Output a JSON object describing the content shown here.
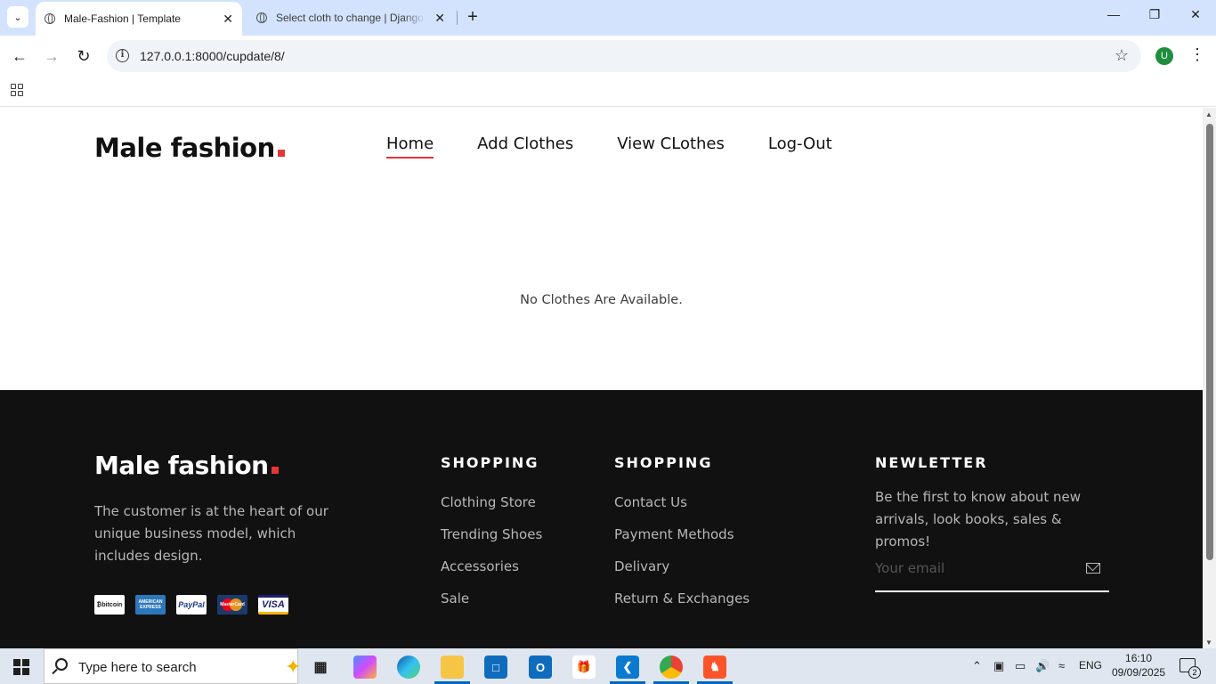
{
  "browser": {
    "tabs": [
      {
        "title": "Male-Fashion | Template",
        "active": true
      },
      {
        "title": "Select cloth to change | Django",
        "active": false
      }
    ],
    "url": "127.0.0.1:8000/cupdate/8/",
    "profile_initial": "U"
  },
  "site": {
    "logo_text": "Male fashion",
    "nav": [
      {
        "label": "Home",
        "active": true
      },
      {
        "label": "Add Clothes",
        "active": false
      },
      {
        "label": "View CLothes",
        "active": false
      },
      {
        "label": "Log-Out",
        "active": false
      }
    ],
    "empty_message": "No Clothes Are Available."
  },
  "footer": {
    "logo_text": "Male fashion",
    "about": "The customer is at the heart of our unique business model, which includes design.",
    "payments": [
      "bitcoin",
      "American Express",
      "PayPal",
      "MasterCard",
      "VISA"
    ],
    "col1": {
      "title": "SHOPPING",
      "links": [
        "Clothing Store",
        "Trending Shoes",
        "Accessories",
        "Sale"
      ]
    },
    "col2": {
      "title": "SHOPPING",
      "links": [
        "Contact Us",
        "Payment Methods",
        "Delivary",
        "Return & Exchanges"
      ]
    },
    "newsletter": {
      "title": "NEWLETTER",
      "text": "Be the first to know about new arrivals, look books, sales & promos!",
      "placeholder": "Your email"
    }
  },
  "taskbar": {
    "search_placeholder": "Type here to search",
    "language": "ENG",
    "time": "16:10",
    "date": "09/09/2025",
    "notification_count": "2"
  },
  "colors": {
    "accent": "#e53637",
    "footer_bg": "#111111",
    "tab_bar": "#d3e3fd"
  }
}
